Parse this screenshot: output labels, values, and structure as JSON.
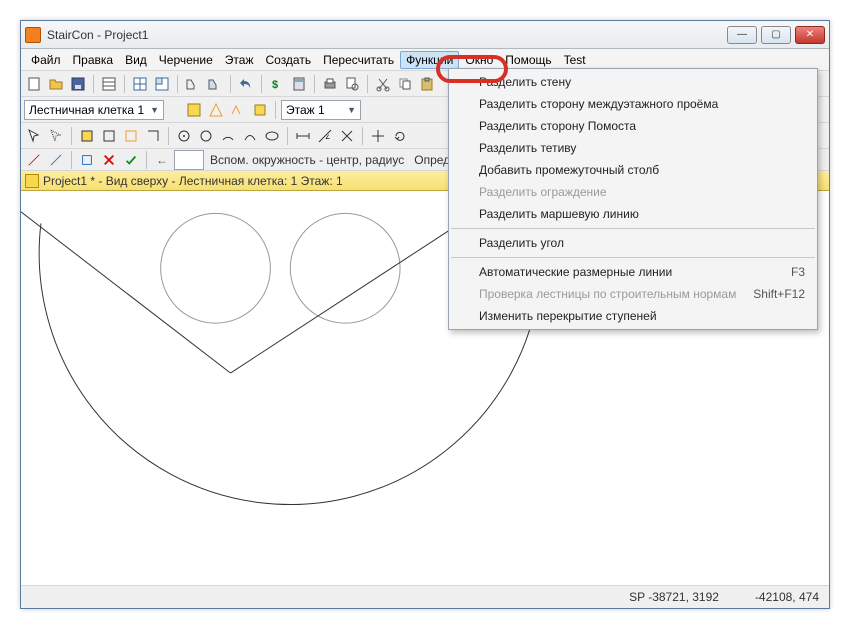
{
  "title": "StairCon - Project1",
  "menubar": [
    "Файл",
    "Правка",
    "Вид",
    "Черчение",
    "Этаж",
    "Создать",
    "Пересчитать",
    "Функции",
    "Окно",
    "Помощь",
    "Test"
  ],
  "activeMenuIndex": 7,
  "dropdown": {
    "items": [
      {
        "label": "Разделить стену",
        "disabled": false
      },
      {
        "label": "Разделить сторону междуэтажного проёма",
        "disabled": false
      },
      {
        "label": "Разделить сторону Помоста",
        "disabled": false
      },
      {
        "label": "Разделить тетиву",
        "disabled": false
      },
      {
        "label": "Добавить промежуточный столб",
        "disabled": false
      },
      {
        "label": "Разделить ограждение",
        "disabled": true
      },
      {
        "label": "Разделить маршевую линию",
        "disabled": false
      },
      {
        "sep": true
      },
      {
        "label": "Разделить угол",
        "disabled": false
      },
      {
        "sep": true
      },
      {
        "label": "Автоматические размерные линии",
        "shortcut": "F3",
        "disabled": false
      },
      {
        "label": "Проверка лестницы по строительным нормам",
        "shortcut": "Shift+F12",
        "disabled": true
      },
      {
        "label": "Изменить перекрытие ступеней",
        "disabled": false
      }
    ]
  },
  "combo": {
    "stairwell": "Лестничная клетка 1",
    "floor": "Этаж 1"
  },
  "promptBar": {
    "hint": "Вспом. окружность - центр, радиус",
    "extra": "Определит"
  },
  "docHeader": "Project1 * - Вид сверху - Лестничная клетка: 1 Этаж: 1",
  "status": {
    "sp": "SP  -38721,  3192",
    "coord": "-42108,   474"
  },
  "icons": {
    "new": "new-icon",
    "open": "open-icon",
    "save": "save-icon",
    "props": "props-icon",
    "grid1": "grid1-icon",
    "grid2": "grid2-icon",
    "l1": "l1-icon",
    "l2": "l2-icon",
    "undo": "undo-icon",
    "money": "money-icon",
    "calc": "calc-icon",
    "print": "print-icon",
    "preview": "preview-icon",
    "cut": "cut-icon",
    "copy": "copy-icon",
    "paste": "paste-icon"
  }
}
